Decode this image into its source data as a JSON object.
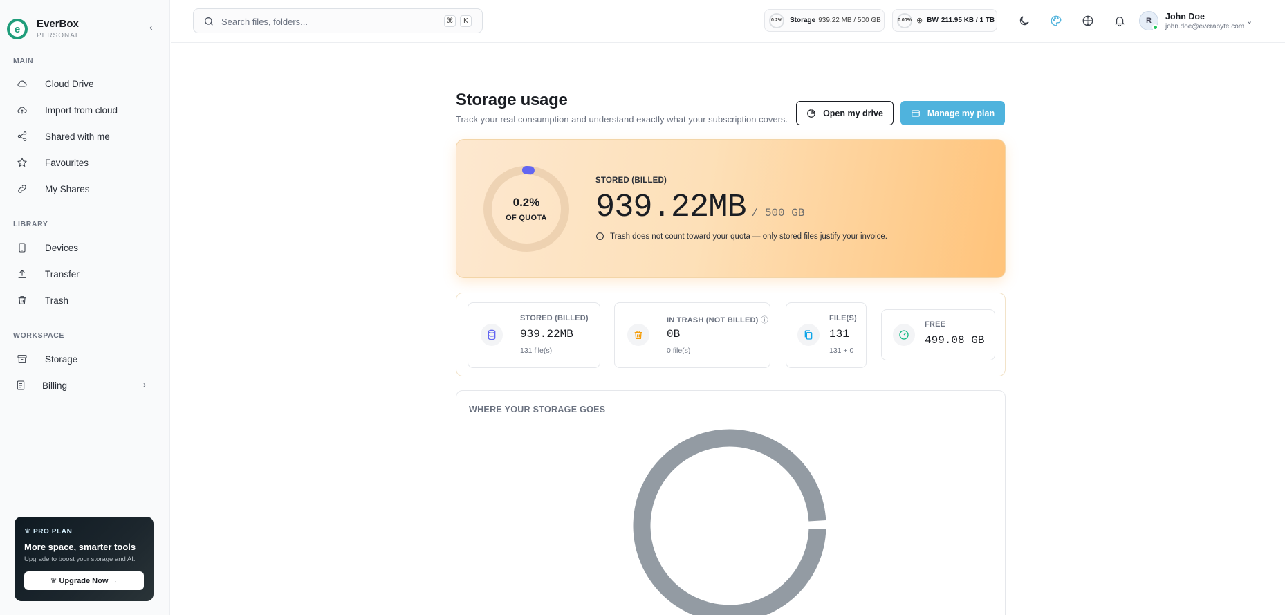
{
  "brand": {
    "name": "EverBox",
    "subtitle": "PERSONAL"
  },
  "sidebar": {
    "sections": [
      {
        "title": "MAIN",
        "items": [
          {
            "label": "Cloud Drive",
            "icon": "cloud-icon"
          },
          {
            "label": "Import from cloud",
            "icon": "cloud-upload-icon"
          },
          {
            "label": "Shared with me",
            "icon": "share-icon"
          },
          {
            "label": "Favourites",
            "icon": "star-icon"
          },
          {
            "label": "My Shares",
            "icon": "link-icon"
          }
        ]
      },
      {
        "title": "LIBRARY",
        "items": [
          {
            "label": "Devices",
            "icon": "device-icon"
          },
          {
            "label": "Transfer",
            "icon": "upload-icon"
          },
          {
            "label": "Trash",
            "icon": "trash-icon"
          }
        ]
      },
      {
        "title": "WORKSPACE",
        "items": [
          {
            "label": "Storage",
            "icon": "archive-icon"
          },
          {
            "label": "Billing",
            "icon": "billing-icon"
          }
        ]
      }
    ],
    "promo": {
      "badge": "PRO PLAN",
      "title": "More space, smarter tools",
      "description": "Upgrade to boost your storage and AI.",
      "button": "Upgrade Now →"
    }
  },
  "topbar": {
    "search_placeholder": "Search files, folders...",
    "shortcut_keys": [
      "⌘",
      "K"
    ],
    "storage_pill": {
      "pct": "0.2%",
      "label": "Storage",
      "value": "939.22 MB / 500 GB"
    },
    "bandwidth_pill": {
      "pct": "0.00%",
      "label": "BW",
      "value": "211.95 KB / 1 TB"
    },
    "user": {
      "initial": "R",
      "name": "John Doe",
      "email": "john.doe@everabyte.com"
    }
  },
  "page": {
    "title": "Storage usage",
    "subtitle": "Track your real consumption and understand exactly what your subscription covers.",
    "open_drive": "Open my drive",
    "manage_plan": "Manage my plan"
  },
  "hero": {
    "quota_pct": "0.2%",
    "quota_fraction": 0.002,
    "quota_label": "OF QUOTA",
    "stored_label": "STORED (BILLED)",
    "stored_value": "939.22MB",
    "quota_total": "/ 500 GB",
    "note": "Trash does not count toward your quota — only stored files justify your invoice."
  },
  "stats": [
    {
      "label": "STORED (BILLED)",
      "value": "939.22MB",
      "sub": "131 file(s)",
      "icon": "database-icon",
      "color": "#6366f1"
    },
    {
      "label": "IN TRASH (NOT BILLED)",
      "value": "0B",
      "sub": "0 file(s)",
      "icon": "trash-icon",
      "color": "#f59e0b"
    },
    {
      "label": "FILE(S)",
      "value": "131",
      "sub": "131 + 0",
      "icon": "files-icon",
      "color": "#0ea5e9"
    },
    {
      "label": "FREE",
      "value": "499.08 GB",
      "sub": "",
      "icon": "gauge-icon",
      "color": "#10b981"
    }
  ],
  "where": {
    "title": "WHERE YOUR STORAGE GOES"
  },
  "colors": {
    "accent": "#4fb3dd",
    "brand": "#1f9d7a",
    "quota_ring": "#6366f1",
    "donut": "#939ba3"
  }
}
